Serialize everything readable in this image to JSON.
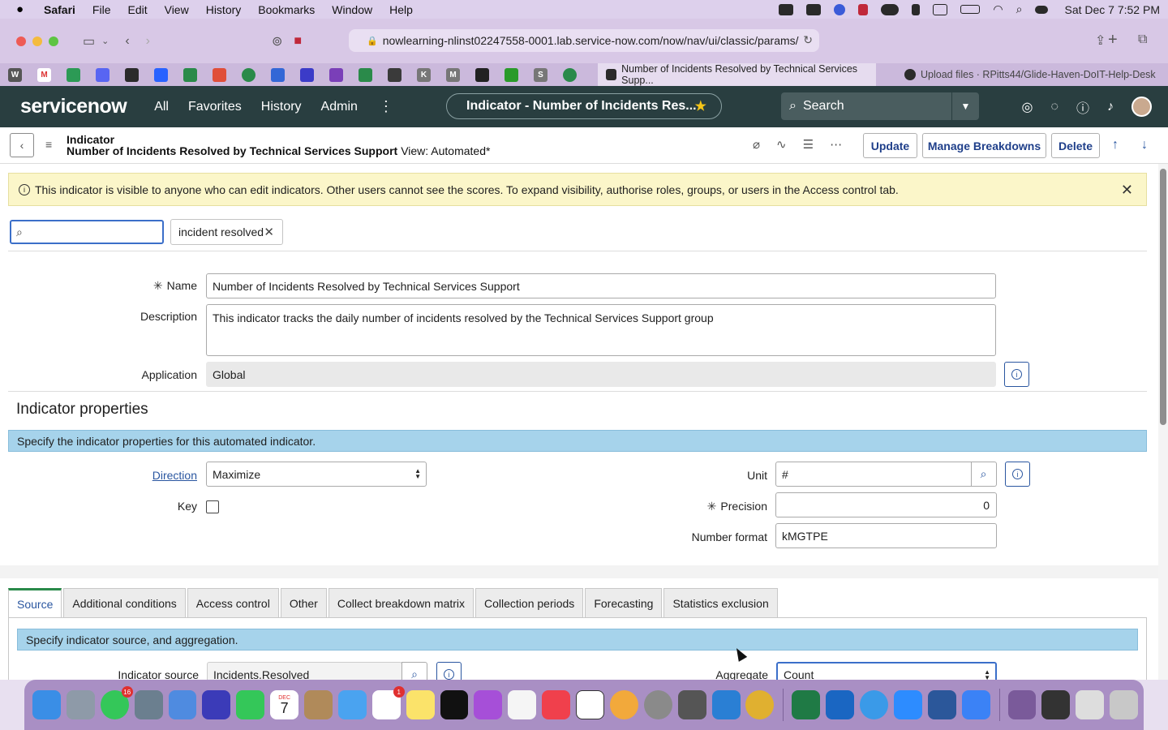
{
  "menubar": {
    "app": "Safari",
    "items": [
      "File",
      "Edit",
      "View",
      "History",
      "Bookmarks",
      "Window",
      "Help"
    ],
    "clock": "Sat Dec 7  7:52 PM"
  },
  "browser": {
    "url": "nowlearning-nlinst02247558-0001.lab.service-now.com/now/nav/ui/classic/params/",
    "active_tab": "Number of Incidents Resolved by Technical Services Supp...",
    "inactive_tab": "Upload files · RPitts44/Glide-Haven-DoIT-Help-Desk"
  },
  "sn_header": {
    "logo": "servicenow",
    "nav": [
      "All",
      "Favorites",
      "History",
      "Admin"
    ],
    "context_pill": "Indicator - Number of Incidents Res...",
    "search_placeholder": "Search"
  },
  "form_header": {
    "table": "Indicator",
    "record": "Number of Incidents Resolved by Technical Services Support",
    "view": "View: Automated*",
    "buttons": {
      "update": "Update",
      "manage": "Manage Breakdowns",
      "delete": "Delete"
    }
  },
  "notice": "This indicator is visible to anyone who can edit indicators. Other users cannot see the scores. To expand visibility, authorise roles, groups, or users in the Access control tab.",
  "filter": {
    "value": "",
    "tag": "incident resolved"
  },
  "fields": {
    "name_label": "Name",
    "name_value": "Number of Incidents Resolved by Technical Services Support",
    "description_label": "Description",
    "description_value": "This indicator tracks the daily number of incidents resolved by the Technical Services Support group",
    "application_label": "Application",
    "application_value": "Global"
  },
  "properties": {
    "title": "Indicator properties",
    "banner": "Specify the indicator properties for this automated indicator.",
    "direction_label": "Direction",
    "direction_value": "Maximize",
    "key_label": "Key",
    "unit_label": "Unit",
    "unit_value": "#",
    "precision_label": "Precision",
    "precision_value": "0",
    "number_format_label": "Number format",
    "number_format_value": "kMGTPE"
  },
  "tabs": [
    "Source",
    "Additional conditions",
    "Access control",
    "Other",
    "Collect breakdown matrix",
    "Collection periods",
    "Forecasting",
    "Statistics exclusion"
  ],
  "source": {
    "banner": "Specify indicator source, and aggregation.",
    "indicator_source_label": "Indicator source",
    "indicator_source_value": "Incidents.Resolved",
    "aggregate_label": "Aggregate",
    "aggregate_value": "Count"
  },
  "dock_badges": {
    "messages": "16",
    "reminders": "1",
    "calendar_month": "DEC",
    "calendar_day": "7"
  },
  "colors": {
    "sn_header": "#293e40",
    "notice": "#fbf6c9",
    "banner": "#a6d3eb",
    "link": "#2a56a0"
  }
}
